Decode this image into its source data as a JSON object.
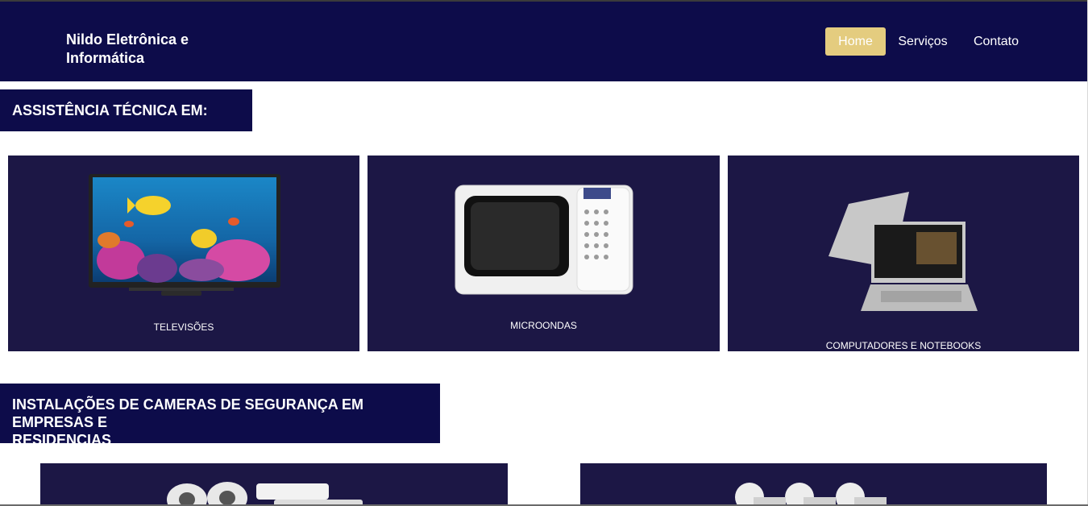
{
  "header": {
    "brand_line1": "Nildo Eletrônica e",
    "brand_line2": "Informática",
    "nav": [
      {
        "label": "Home",
        "active": true
      },
      {
        "label": "Serviços",
        "active": false
      },
      {
        "label": "Contato",
        "active": false
      }
    ]
  },
  "sections": {
    "assistance_title": "ASSISTÊNCIA TÉCNICA EM:",
    "cameras_title_line1": "INSTALAÇÕES DE CAMERAS DE SEGURANÇA EM EMPRESAS E",
    "cameras_title_line2": "RESIDENCIAS"
  },
  "cards": [
    {
      "caption": "TELEVISÕES",
      "icon": "tv-image"
    },
    {
      "caption": "MICROONDAS",
      "icon": "microwave-image"
    },
    {
      "caption": "COMPUTADORES E NOTEBOOKS",
      "icon": "laptop-image"
    }
  ],
  "camera_cards": [
    {
      "icon": "security-camera-kit-image"
    },
    {
      "icon": "bullet-cameras-image"
    }
  ],
  "colors": {
    "header_bg": "#0d0c4a",
    "card_bg": "#1c1745",
    "nav_active_bg": "#e4cc7f"
  }
}
